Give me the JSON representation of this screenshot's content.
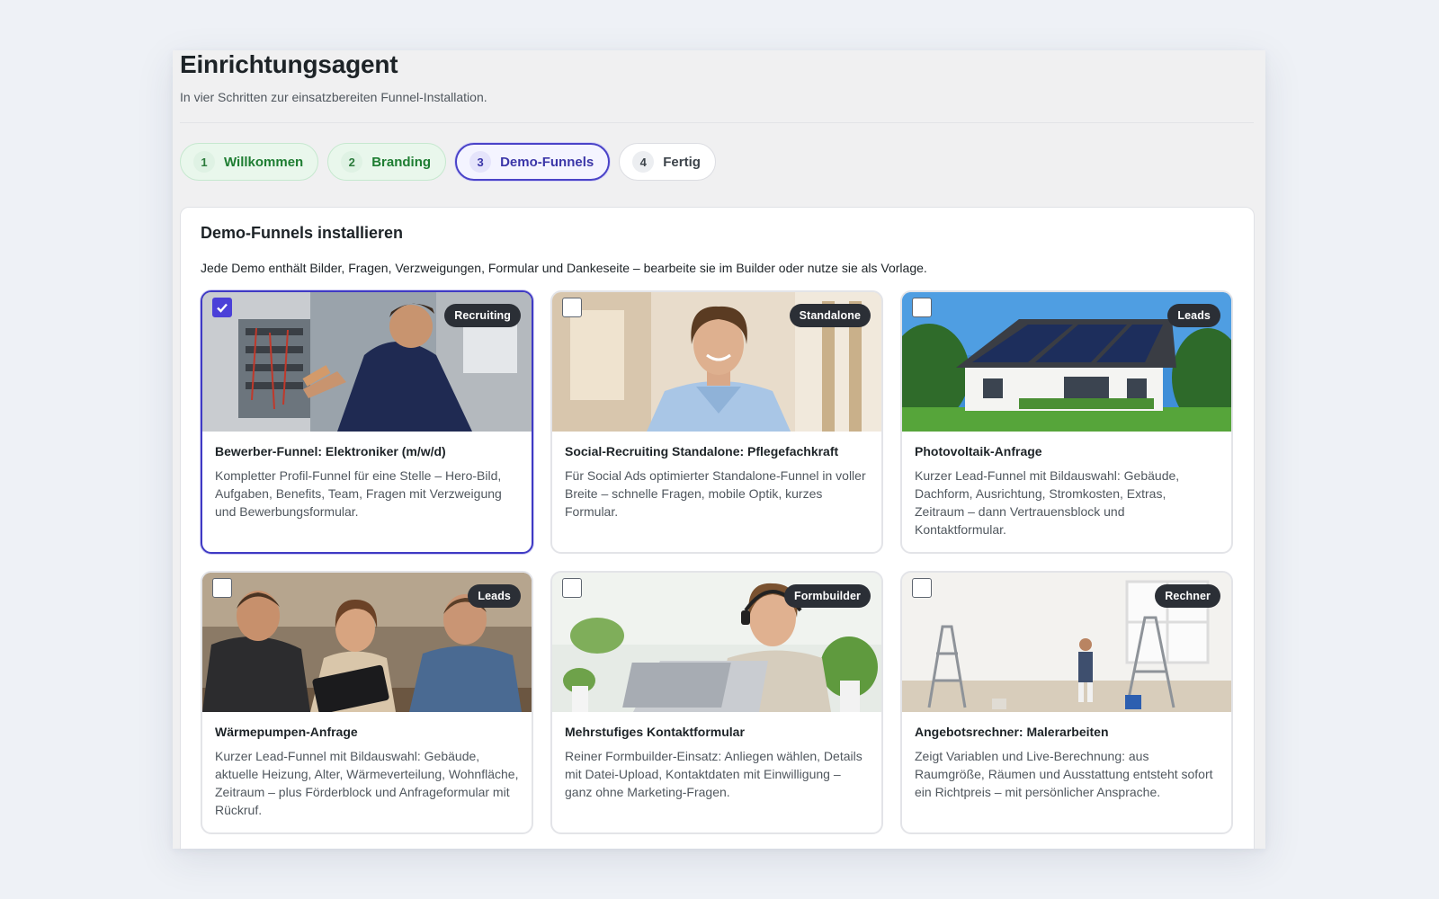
{
  "header": {
    "title": "Einrichtungsagent",
    "subtitle": "In vier Schritten zur einsatzbereiten Funnel-Installation."
  },
  "steps": [
    {
      "num": "1",
      "label": "Willkommen",
      "state": "done"
    },
    {
      "num": "2",
      "label": "Branding",
      "state": "done"
    },
    {
      "num": "3",
      "label": "Demo-Funnels",
      "state": "active"
    },
    {
      "num": "4",
      "label": "Fertig",
      "state": "todo"
    }
  ],
  "panel": {
    "title": "Demo-Funnels installieren",
    "description": "Jede Demo enthält Bilder, Fragen, Verzweigungen, Formular und Dankeseite – bearbeite sie im Builder oder nutze sie als Vorlage."
  },
  "cards": [
    {
      "badge": "Recruiting",
      "title": "Bewerber-Funnel: Elektroniker (m/w/d)",
      "description": "Kompletter Profil-Funnel für eine Stelle – Hero-Bild, Aufgaben, Benefits, Team, Fragen mit Verzweigung und Bewerbungsformular.",
      "selected": true,
      "image": "electrician-at-panel"
    },
    {
      "badge": "Standalone",
      "title": "Social-Recruiting Standalone: Pflegefachkraft",
      "description": "Für Social Ads optimierter Standalone-Funnel in voller Breite – schnelle Fragen, mobile Optik, kurzes Formular.",
      "selected": false,
      "image": "nurse-in-hallway"
    },
    {
      "badge": "Leads",
      "title": "Photovoltaik-Anfrage",
      "description": "Kurzer Lead-Funnel mit Bildauswahl: Gebäude, Dachform, Ausrichtung, Stromkosten, Extras, Zeitraum – dann Vertrauensblock und Kontaktformular.",
      "selected": false,
      "image": "house-with-solar-panels"
    },
    {
      "badge": "Leads",
      "title": "Wärmepumpen-Anfrage",
      "description": "Kurzer Lead-Funnel mit Bildauswahl: Gebäude, aktuelle Heizung, Alter, Wärmeverteilung, Wohnfläche, Zeitraum – plus Förderblock und Anfrageformular mit Rückruf.",
      "selected": false,
      "image": "consultation-with-tablet"
    },
    {
      "badge": "Formbuilder",
      "title": "Mehrstufiges Kontaktformular",
      "description": "Reiner Formbuilder-Einsatz: Anliegen wählen, Details mit Datei-Upload, Kontaktdaten mit Einwilligung – ganz ohne Marketing-Fragen.",
      "selected": false,
      "image": "support-agent-with-headset"
    },
    {
      "badge": "Rechner",
      "title": "Angebotsrechner: Malerarbeiten",
      "description": "Zeigt Variablen und Live-Berechnung: aus Raumgröße, Räumen und Ausstattung entsteht sofort ein Richtpreis – mit persönlicher Ansprache.",
      "selected": false,
      "image": "painter-in-empty-room"
    }
  ],
  "colors": {
    "accent": "#4b40d8",
    "done_step": "#1e7d32",
    "badge_bg": "#2b2f36"
  }
}
